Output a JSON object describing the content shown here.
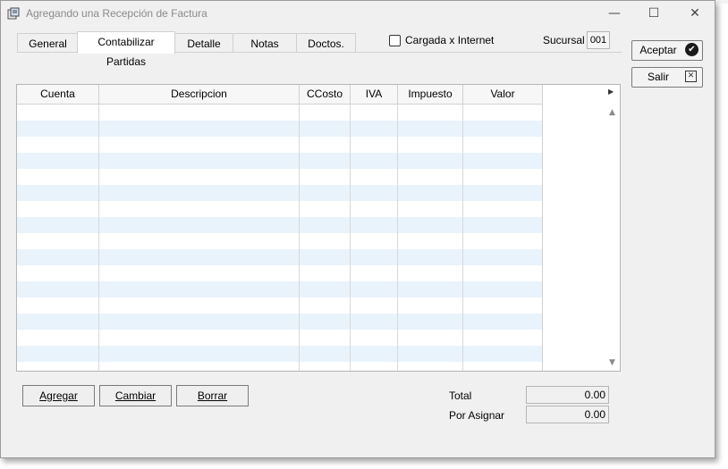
{
  "window": {
    "title": "Agregando una Recepción de Factura",
    "controls": {
      "minimize": "—",
      "maximize": "☐",
      "close": "✕"
    }
  },
  "tabs": [
    {
      "label": "General"
    },
    {
      "label": "Contabilizar Partidas"
    },
    {
      "label": "Detalle"
    },
    {
      "label": "Notas"
    },
    {
      "label": "Doctos."
    }
  ],
  "options": {
    "internet_label": "Cargada x Internet",
    "internet_checked": false
  },
  "sucursal": {
    "label": "Sucursal",
    "value": "001"
  },
  "table": {
    "columns": [
      "Cuenta",
      "Descripcion",
      "CCosto",
      "IVA",
      "Impuesto",
      "Valor"
    ],
    "rows": []
  },
  "side_buttons": {
    "accept": "Aceptar",
    "exit": "Salir"
  },
  "actions": {
    "add": "Agregar",
    "change": "Cambiar",
    "delete": "Borrar"
  },
  "totals": {
    "total_label": "Total",
    "total_value": "0.00",
    "pending_label": "Por Asignar",
    "pending_value": "0.00"
  },
  "colors": {
    "row_alt": "#e9f3fc",
    "background": "#f0f0f0"
  },
  "icons": [
    "app-icon",
    "check-circle-icon",
    "close-box-icon",
    "scroll-up-icon",
    "scroll-down-icon",
    "scroll-right-icon"
  ]
}
